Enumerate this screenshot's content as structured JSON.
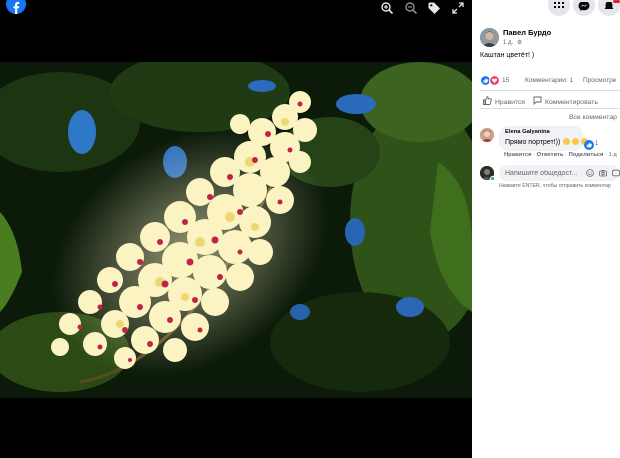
{
  "viewer": {
    "icons": [
      "facebook-logo-icon",
      "zoom-in-icon",
      "zoom-out-icon",
      "tag-icon",
      "fullscreen-icon"
    ]
  },
  "header": {
    "icons": [
      "menu-grid-icon",
      "messenger-icon",
      "notifications-bell-icon"
    ]
  },
  "post": {
    "author": "Павел Бурдо",
    "time": "1 д.",
    "text": "Каштан цветёт! )",
    "reactions": {
      "types": [
        "like-reaction-icon",
        "love-reaction-icon"
      ],
      "count": "15"
    },
    "comments_count": "Комментарии: 1",
    "views": "Просмотре"
  },
  "actions": {
    "like": "Нравится",
    "comment": "Комментировать"
  },
  "comments": {
    "all_label": "Все комментар",
    "items": [
      {
        "author": "Elena Galyanina",
        "text": "Прямо портрет!))",
        "reaction_count": "1",
        "like_label": "Нравится",
        "reply_label": "Ответить",
        "share_label": "Поделиться",
        "time": "1 д"
      }
    ]
  },
  "composer": {
    "placeholder": "Напишите общедост...",
    "hint": "Нажмите ENTER, чтобы отправить комментар"
  },
  "colors": {
    "facebook_blue": "#1877f2",
    "love_red": "#f33e58",
    "panel_bg": "#ffffff",
    "viewer_bg": "#000000"
  }
}
